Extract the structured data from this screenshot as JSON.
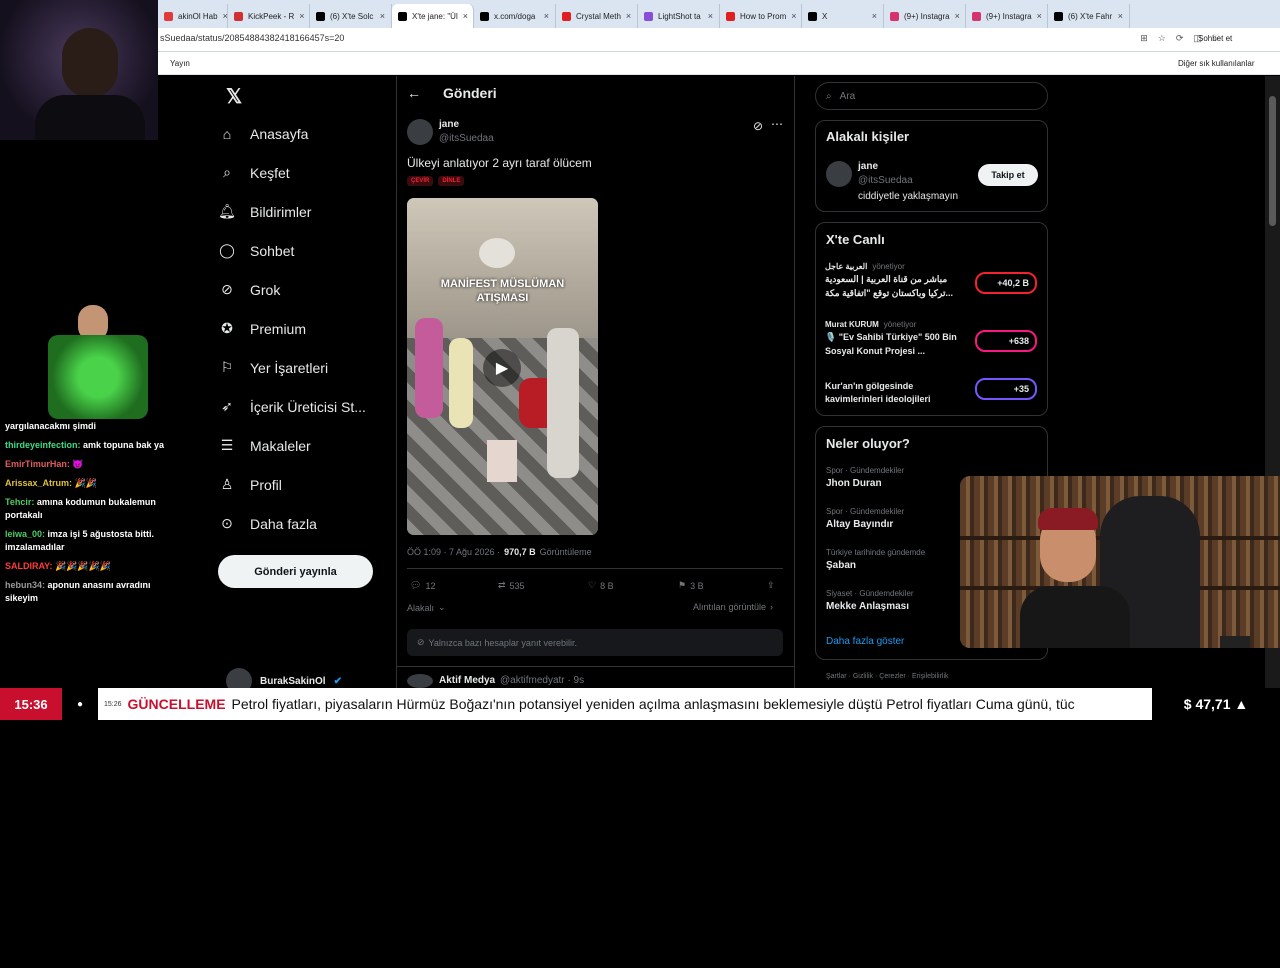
{
  "browser": {
    "tabs": [
      {
        "label": "akinOl Hab",
        "color": "#e03b3b"
      },
      {
        "label": "KickPeek - R",
        "color": "#d23030"
      },
      {
        "label": "(6) X'te Solc",
        "color": "#000000"
      },
      {
        "label": "X'te jane: \"Ül",
        "color": "#000000",
        "active": true
      },
      {
        "label": "x.com/doga",
        "color": "#000000"
      },
      {
        "label": "Crystal Meth",
        "color": "#e02020"
      },
      {
        "label": "LightShot ta",
        "color": "#8a4dd6"
      },
      {
        "label": "How to Prom",
        "color": "#e02020"
      },
      {
        "label": "X",
        "color": "#000000"
      },
      {
        "label": "(9+) Instagra",
        "color": "#d6336c"
      },
      {
        "label": "(9+) Instagra",
        "color": "#d6336c"
      },
      {
        "label": "(6) X'te Fahr",
        "color": "#000000"
      }
    ],
    "url": "sSuedaa/status/20854884382418166457s=20",
    "bookmark_left": "Yayın",
    "bookmark_right": "Diğer sık kullanılanlar",
    "sohbet_btn": "Sohbet et"
  },
  "nav": {
    "items": [
      {
        "label": "Anasayfa",
        "icon": "home-icon"
      },
      {
        "label": "Keşfet",
        "icon": "search-icon"
      },
      {
        "label": "Bildirimler",
        "icon": "bell-icon"
      },
      {
        "label": "Sohbet",
        "icon": "chat-icon"
      },
      {
        "label": "Grok",
        "icon": "grok-icon"
      },
      {
        "label": "Premium",
        "icon": "premium-icon"
      },
      {
        "label": "Yer İşaretleri",
        "icon": "bookmark-icon"
      },
      {
        "label": "İçerik Üreticisi St...",
        "icon": "rocket-icon"
      },
      {
        "label": "Makaleler",
        "icon": "article-icon"
      },
      {
        "label": "Profil",
        "icon": "profile-icon"
      },
      {
        "label": "Daha fazla",
        "icon": "more-icon"
      }
    ],
    "post_button": "Gönderi yayınla",
    "profile_name": "BurakSakinOl"
  },
  "post": {
    "header": "Gönderi",
    "author_name": "jane",
    "author_handle": "@itsSuedaa",
    "text": "Ülkeyi anlatıyor 2 ayrı taraf  ölücem",
    "tags": [
      "ÇEVİR",
      "DİNLE"
    ],
    "video_title_1": "MANİFEST MÜSLÜMAN",
    "video_title_2": "ATIŞMASI",
    "timestamp": "ÖÖ 1:09 · 7 Ağu 2026 · ",
    "views": "970,7 B",
    "views_label": " Görüntüleme",
    "replies": "12",
    "reposts": "535",
    "likes": "8 B",
    "bookmarks": "3 B",
    "related_label": "Alakalı",
    "quotes_label": "Alıntıları görüntüle",
    "reply_restricted": "Yalnızca bazı hesaplar yanıt verebilir.",
    "next_author": "Aktif Medya",
    "next_handle": "@aktifmedyatr · 9s"
  },
  "right": {
    "search_placeholder": "Ara",
    "related_title": "Alakalı kişiler",
    "related_name": "jane",
    "related_handle": "@itsSuedaa",
    "related_bio": "ciddiyetle yaklaşmayın",
    "follow_button": "Takip et",
    "live_title": "X'te Canlı",
    "live": [
      {
        "host": "العربية عاجل",
        "role": "yönetiyor",
        "title1": "مباشر من قناة العربية | السعودية",
        "title2": "تركيا وباكستان توقع \"اتفاقية مكة...",
        "count": "+40,2 B",
        "color": "#f4212e"
      },
      {
        "host": "Murat KURUM",
        "role": "yönetiyor",
        "title1": "🎙️ \"Ev Sahibi Türkiye\" 500 Bin",
        "title2": "Sosyal Konut Projesi ...",
        "count": "+638",
        "color": "#f91880"
      },
      {
        "host": "",
        "role": "",
        "title1": "Kur'an'ın gölgesinde",
        "title2": "kavimlerinleri ideolojileri",
        "count": "+35",
        "color": "#7856ff"
      }
    ],
    "trends_title": "Neler oluyor?",
    "trends": [
      {
        "context": "Spor · Gündemdekiler",
        "name": "Jhon Duran"
      },
      {
        "context": "Spor · Gündemdekiler",
        "name": "Altay Bayındır"
      },
      {
        "context": "Türkiye tarihinde gündemde",
        "name": "Şaban"
      },
      {
        "context": "Siyaset · Gündemdekiler",
        "name": "Mekke Anlaşması"
      }
    ],
    "show_more": "Daha fazla göster",
    "footer": "Şartlar · Gizlilik · Çerezler · Erişilebilirlik"
  },
  "chat": [
    {
      "user": "",
      "msg": "yargılanacakmı şimdi",
      "color": "#ffffff"
    },
    {
      "user": "thirdeyeinfection:",
      "msg": " amk topuna bak ya",
      "color": "#3ddc84"
    },
    {
      "user": "EmirTimurHan:",
      "msg": " 😈",
      "color": "#e05c5c"
    },
    {
      "user": "Arissax_Atrum:",
      "msg": " 🎉🎉",
      "color": "#e0c040"
    },
    {
      "user": "Tehcir:",
      "msg": " amına kodumun bukalemun portakalı",
      "color": "#4ccc66"
    },
    {
      "user": "leiwa_00:",
      "msg": " imza işi 5 ağustosta bitti. imzalamadılar",
      "color": "#4ccc66"
    },
    {
      "user": "SALDIRAY:",
      "msg": " 🎉🎉🎉🎉🎉",
      "color": "#ff3b3b"
    },
    {
      "user": "hebun34:",
      "msg": " aponun anasını avradını sikeyim",
      "color": "#9a9a9a"
    }
  ],
  "ticker": {
    "time": "15:36",
    "small_time": "15:26",
    "label": "GÜNCELLEME",
    "text": "Petrol fiyatları, piyasaların Hürmüz Boğazı'nın potansiyel yeniden açılma anlaşmasını beklemesiyle düştü Petrol fiyatları Cuma günü, tüc",
    "price": "$ 47,71 ▲"
  }
}
